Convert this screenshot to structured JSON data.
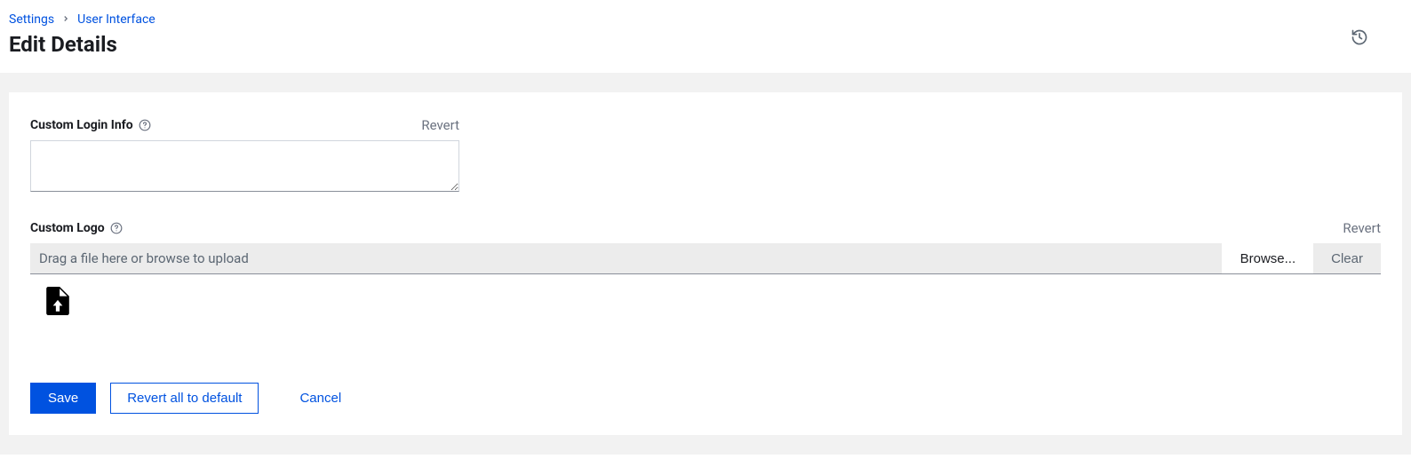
{
  "breadcrumb": {
    "settings": "Settings",
    "user_interface": "User Interface"
  },
  "page_title": "Edit Details",
  "fields": {
    "custom_login_info": {
      "label": "Custom Login Info",
      "revert": "Revert",
      "value": ""
    },
    "custom_logo": {
      "label": "Custom Logo",
      "revert": "Revert",
      "placeholder": "Drag a file here or browse to upload",
      "browse": "Browse...",
      "clear": "Clear"
    }
  },
  "actions": {
    "save": "Save",
    "revert_all": "Revert all to default",
    "cancel": "Cancel"
  }
}
